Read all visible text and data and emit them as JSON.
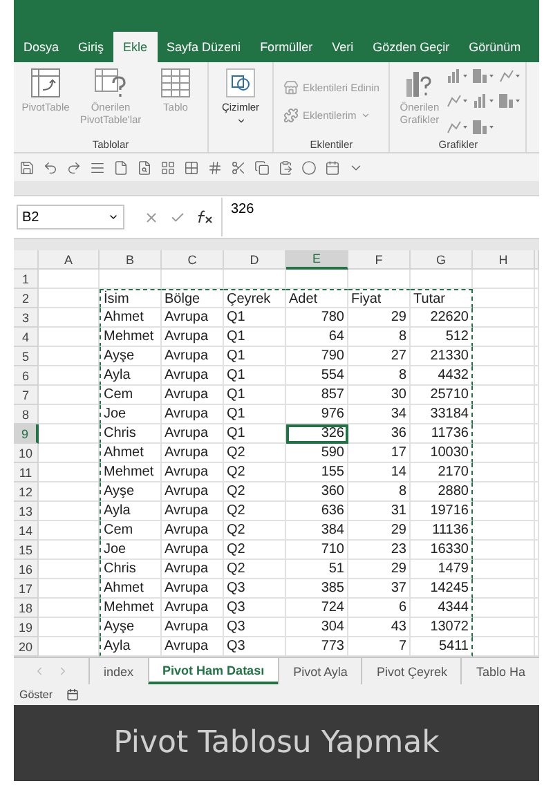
{
  "ribbon_tabs": [
    {
      "label": "Dosya",
      "selected": false
    },
    {
      "label": "Giriş",
      "selected": false
    },
    {
      "label": "Ekle",
      "selected": true
    },
    {
      "label": "Sayfa Düzeni",
      "selected": false
    },
    {
      "label": "Formüller",
      "selected": false
    },
    {
      "label": "Veri",
      "selected": false
    },
    {
      "label": "Gözden Geçir",
      "selected": false
    },
    {
      "label": "Görünüm",
      "selected": false
    }
  ],
  "ribbon_groups": [
    {
      "label": "Tablolar",
      "kind": "large",
      "buttons": [
        {
          "label": "PivotTable",
          "dropdown": false
        },
        {
          "label": "Önerilen PivotTable'lar",
          "dropdown": false
        },
        {
          "label": "Tablo",
          "dropdown": false
        }
      ]
    },
    {
      "kind": "large",
      "buttons": [
        {
          "label": "Çizimler",
          "dropdown": true
        }
      ]
    },
    {
      "label": "Eklentiler",
      "kind": "list",
      "buttons": [
        {
          "label": "Eklentileri Edinin",
          "dropdown": false
        },
        {
          "label": "Eklentilerim",
          "dropdown": true
        }
      ]
    },
    {
      "label": "Grafikler",
      "kind": "charts",
      "buttons": [
        {
          "label": "Önerilen Grafikler",
          "dropdown": false
        }
      ]
    }
  ],
  "name_box": "B2",
  "formula": "326",
  "columns": [
    {
      "label": "A",
      "selected": false
    },
    {
      "label": "B",
      "selected": false
    },
    {
      "label": "C",
      "selected": false
    },
    {
      "label": "D",
      "selected": false
    },
    {
      "label": "E",
      "selected": true
    },
    {
      "label": "F",
      "selected": false
    },
    {
      "label": "G",
      "selected": false
    },
    {
      "label": "H",
      "selected": false
    }
  ],
  "rows": [
    {
      "number": "1",
      "selected": false
    },
    {
      "number": "2",
      "selected": false,
      "cells": [
        "İsim",
        "Bölge",
        "Çeyrek",
        "Adet",
        "Fiyat",
        "Tutar"
      ],
      "kind": "header"
    },
    {
      "number": "3",
      "selected": false,
      "cells": [
        "Ahmet",
        "Avrupa",
        "Q1",
        "780",
        "29",
        "22620"
      ]
    },
    {
      "number": "4",
      "selected": false,
      "cells": [
        "Mehmet",
        "Avrupa",
        "Q1",
        "64",
        "8",
        "512"
      ]
    },
    {
      "number": "5",
      "selected": false,
      "cells": [
        "Ayşe",
        "Avrupa",
        "Q1",
        "790",
        "27",
        "21330"
      ]
    },
    {
      "number": "6",
      "selected": false,
      "cells": [
        "Ayla",
        "Avrupa",
        "Q1",
        "554",
        "8",
        "4432"
      ]
    },
    {
      "number": "7",
      "selected": false,
      "cells": [
        "Cem",
        "Avrupa",
        "Q1",
        "857",
        "30",
        "25710"
      ]
    },
    {
      "number": "8",
      "selected": false,
      "cells": [
        "Joe",
        "Avrupa",
        "Q1",
        "976",
        "34",
        "33184"
      ]
    },
    {
      "number": "9",
      "selected": true,
      "cells": [
        "Chris",
        "Avrupa",
        "Q1",
        "326",
        "36",
        "11736"
      ]
    },
    {
      "number": "10",
      "selected": false,
      "cells": [
        "Ahmet",
        "Avrupa",
        "Q2",
        "590",
        "17",
        "10030"
      ]
    },
    {
      "number": "11",
      "selected": false,
      "cells": [
        "Mehmet",
        "Avrupa",
        "Q2",
        "155",
        "14",
        "2170"
      ]
    },
    {
      "number": "12",
      "selected": false,
      "cells": [
        "Ayşe",
        "Avrupa",
        "Q2",
        "360",
        "8",
        "2880"
      ]
    },
    {
      "number": "13",
      "selected": false,
      "cells": [
        "Ayla",
        "Avrupa",
        "Q2",
        "636",
        "31",
        "19716"
      ]
    },
    {
      "number": "14",
      "selected": false,
      "cells": [
        "Cem",
        "Avrupa",
        "Q2",
        "384",
        "29",
        "11136"
      ]
    },
    {
      "number": "15",
      "selected": false,
      "cells": [
        "Joe",
        "Avrupa",
        "Q2",
        "710",
        "23",
        "16330"
      ]
    },
    {
      "number": "16",
      "selected": false,
      "cells": [
        "Chris",
        "Avrupa",
        "Q2",
        "51",
        "29",
        "1479"
      ]
    },
    {
      "number": "17",
      "selected": false,
      "cells": [
        "Ahmet",
        "Avrupa",
        "Q3",
        "385",
        "37",
        "14245"
      ]
    },
    {
      "number": "18",
      "selected": false,
      "cells": [
        "Mehmet",
        "Avrupa",
        "Q3",
        "724",
        "6",
        "4344"
      ]
    },
    {
      "number": "19",
      "selected": false,
      "cells": [
        "Ayşe",
        "Avrupa",
        "Q3",
        "304",
        "43",
        "13072"
      ]
    },
    {
      "number": "20",
      "selected": false,
      "cells": [
        "Ayla",
        "Avrupa",
        "Q3",
        "773",
        "7",
        "5411"
      ]
    }
  ],
  "sheet_tabs": [
    {
      "label": "index",
      "selected": false
    },
    {
      "label": "Pivot Ham Datası",
      "selected": true
    },
    {
      "label": "Pivot Ayla",
      "selected": false
    },
    {
      "label": "Pivot Çeyrek",
      "selected": false
    },
    {
      "label": "Tablo Ha",
      "selected": false
    }
  ],
  "status_bar": {
    "label": "Göster"
  },
  "banner": {
    "title": "Pivot Tablosu Yapmak"
  }
}
